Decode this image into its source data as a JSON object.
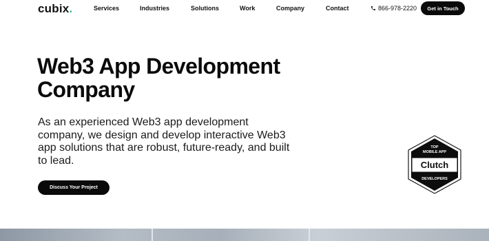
{
  "nav": {
    "logo_text": "cubix",
    "logo_dot": ".",
    "items": [
      "Services",
      "Industries",
      "Solutions",
      "Work",
      "Company",
      "Contact"
    ],
    "phone_icon": "phone-icon",
    "phone": "866-978-2220",
    "cta_label": "Get in Touch"
  },
  "hero": {
    "title": "Web3 App Development Company",
    "description": "As an experienced Web3 app development company, we design and develop interactive Web3 app solutions that are robust, future-ready, and built to lead.",
    "cta_label": "Discuss Your Project"
  },
  "badge": {
    "line1": "TOP",
    "line2": "MOBILE APP",
    "brand": "Clutch",
    "line3": "DEVELOPERS"
  },
  "colors": {
    "accent": "#1fbf8f",
    "button_bg": "#0a0a0a"
  }
}
